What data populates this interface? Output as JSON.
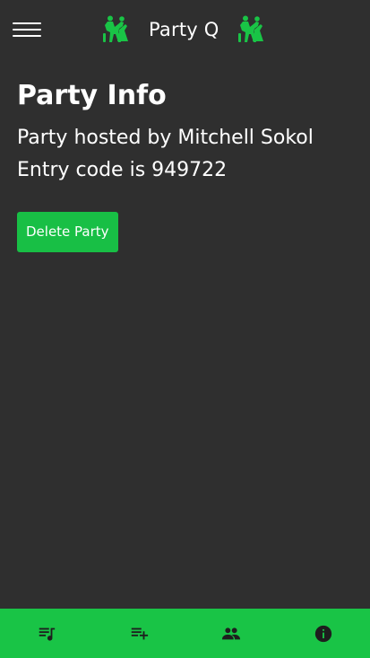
{
  "header": {
    "title": "Party Q",
    "menu_icon": "hamburger-menu-icon",
    "left_logo_icon": "dancing-couple-icon",
    "right_logo_icon": "dancing-couple-icon"
  },
  "main": {
    "title": "Party Info",
    "host_line": "Party hosted by Mitchell Sokol",
    "code_line": "Entry code is 949722",
    "delete_button_label": "Delete Party"
  },
  "bottom_nav": {
    "items": [
      {
        "icon": "queue-music-icon"
      },
      {
        "icon": "playlist-add-icon"
      },
      {
        "icon": "people-icon"
      },
      {
        "icon": "info-icon"
      }
    ]
  },
  "colors": {
    "background": "#2f2f2f",
    "accent": "#19c446",
    "text": "#ffffff",
    "icon_dark": "#1e1e1e"
  }
}
